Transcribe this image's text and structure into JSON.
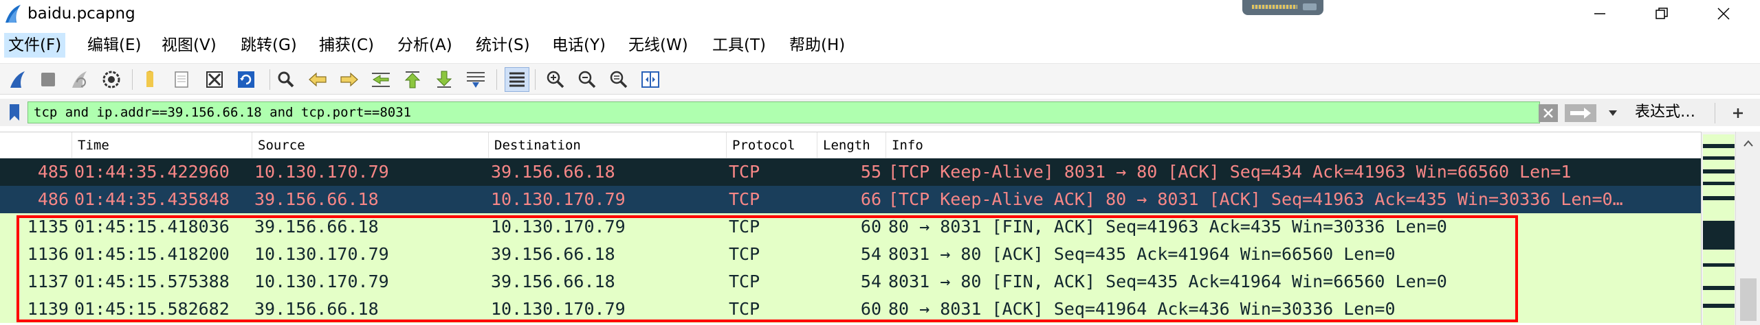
{
  "window": {
    "title": "baidu.pcapng",
    "icons": {
      "app": "wireshark-fin-icon",
      "minimize": "minimize-icon",
      "maximize": "restore-icon",
      "close": "close-icon"
    }
  },
  "menu": [
    "文件(F)",
    "编辑(E)",
    "视图(V)",
    "跳转(G)",
    "捕获(C)",
    "分析(A)",
    "统计(S)",
    "电话(Y)",
    "无线(W)",
    "工具(T)",
    "帮助(H)"
  ],
  "toolbar": {
    "icons": [
      "start-capture-icon",
      "stop-capture-icon",
      "restart-capture-icon",
      "capture-options-icon",
      "open-file-icon",
      "save-file-icon",
      "close-file-icon",
      "reload-file-icon",
      "find-packet-icon",
      "go-back-icon",
      "go-forward-icon",
      "go-to-packet-icon",
      "go-first-icon",
      "go-last-icon",
      "auto-scroll-icon",
      "colorize-icon",
      "zoom-in-icon",
      "zoom-out-icon",
      "zoom-reset-icon",
      "resize-columns-icon"
    ]
  },
  "filter": {
    "value": "tcp and ip.addr==39.156.66.18 and tcp.port==8031",
    "expression_label": "表达式…",
    "add_label": "+",
    "bg_color": "#afffaf"
  },
  "columns": [
    "Time",
    "Source",
    "Destination",
    "Protocol",
    "Length",
    "Info"
  ],
  "packets": [
    {
      "no": "485",
      "time": "01:44:35.422960",
      "source": "10.130.170.79",
      "destination": "39.156.66.18",
      "protocol": "TCP",
      "length": "55",
      "info": "[TCP Keep-Alive] 8031 → 80 [ACK] Seq=434 Ack=41963 Win=66560 Len=1",
      "bg": "#12272e",
      "fg": "#f78787"
    },
    {
      "no": "486",
      "time": "01:44:35.435848",
      "source": "39.156.66.18",
      "destination": "10.130.170.79",
      "protocol": "TCP",
      "length": "66",
      "info": "[TCP Keep-Alive ACK] 80 → 8031 [ACK] Seq=41963 Ack=435 Win=30336 Len=0…",
      "bg": "#1a3e5b",
      "fg": "#f78787"
    },
    {
      "no": "1135",
      "time": "01:45:15.418036",
      "source": "39.156.66.18",
      "destination": "10.130.170.79",
      "protocol": "TCP",
      "length": "60",
      "info": "80 → 8031 [FIN, ACK] Seq=41963 Ack=435 Win=30336 Len=0",
      "bg": "#e7e6ff",
      "fg": "#12272e"
    },
    {
      "no": "1136",
      "time": "01:45:15.418200",
      "source": "10.130.170.79",
      "destination": "39.156.66.18",
      "protocol": "TCP",
      "length": "54",
      "info": "8031 → 80 [ACK] Seq=435 Ack=41964 Win=66560 Len=0",
      "bg": "#e7e6ff",
      "fg": "#12272e"
    },
    {
      "no": "1137",
      "time": "01:45:15.575388",
      "source": "10.130.170.79",
      "destination": "39.156.66.18",
      "protocol": "TCP",
      "length": "54",
      "info": "8031 → 80 [FIN, ACK] Seq=435 Ack=41964 Win=66560 Len=0",
      "bg": "#e7e6ff",
      "fg": "#12272e"
    },
    {
      "no": "1139",
      "time": "01:45:15.582682",
      "source": "39.156.66.18",
      "destination": "10.130.170.79",
      "protocol": "TCP",
      "length": "60",
      "info": "80 → 8031 [ACK] Seq=41964 Ack=436 Win=30336 Len=0",
      "bg": "#e7e6ff",
      "fg": "#12272e"
    }
  ],
  "colors": {
    "highlight_box": "#ff0000",
    "tcp_green": "#e4ffc7",
    "keepalive_dark": "#12272e",
    "selected_dark": "#1a3e5b",
    "keepalive_text": "#f78787"
  }
}
